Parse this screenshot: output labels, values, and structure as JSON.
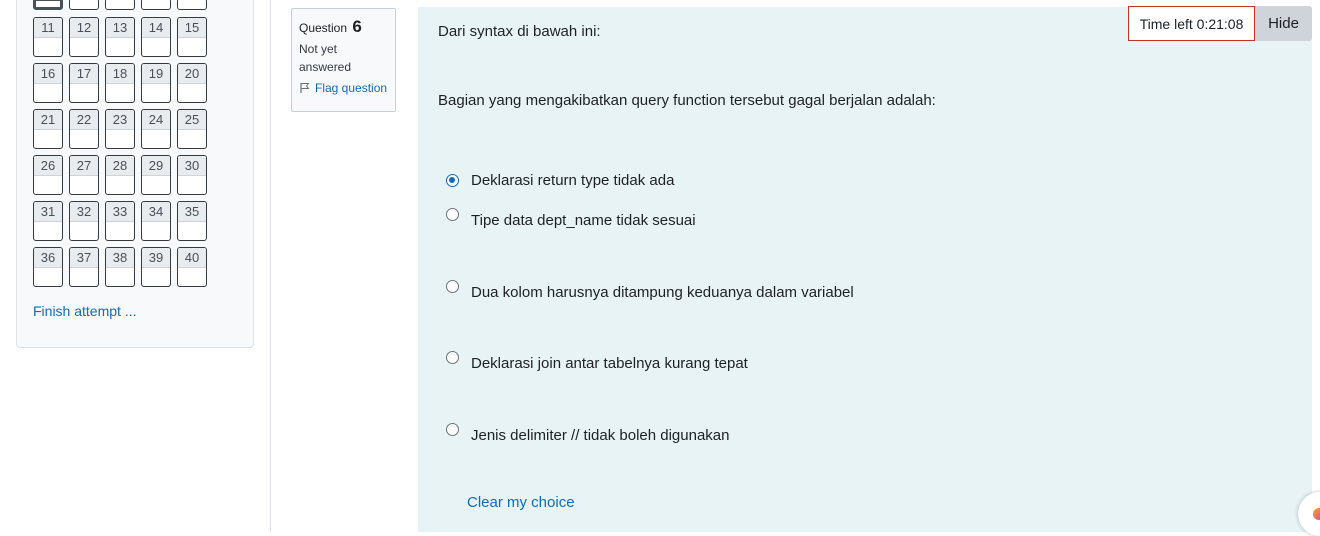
{
  "navigation": {
    "rows": [
      [
        "11",
        "12",
        "13",
        "14",
        "15"
      ],
      [
        "16",
        "17",
        "18",
        "19",
        "20"
      ],
      [
        "21",
        "22",
        "23",
        "24",
        "25"
      ],
      [
        "26",
        "27",
        "28",
        "29",
        "30"
      ],
      [
        "31",
        "32",
        "33",
        "34",
        "35"
      ],
      [
        "36",
        "37",
        "38",
        "39",
        "40"
      ]
    ],
    "finish_label": "Finish attempt ..."
  },
  "question_info": {
    "question_word": "Question",
    "number": "6",
    "state": "Not yet answered",
    "flag_label": "Flag question"
  },
  "question": {
    "intro": "Dari syntax di bawah ini:",
    "prompt": "Bagian yang mengakibatkan query function tersebut gagal berjalan adalah:",
    "options": [
      {
        "label": "Deklarasi return type tidak ada",
        "checked": true
      },
      {
        "label": "Tipe data dept_name tidak sesuai",
        "checked": false
      },
      {
        "label": "Dua kolom harusnya ditampung keduanya dalam variabel",
        "checked": false
      },
      {
        "label": "Deklarasi join antar tabelnya kurang tepat",
        "checked": false
      },
      {
        "label": "Jenis delimiter // tidak boleh digunakan",
        "checked": false
      }
    ],
    "clear_label": "Clear my choice"
  },
  "timer": {
    "text": "Time left 0:21:08",
    "hide_label": "Hide"
  },
  "colors": {
    "link": "#0f6cbf",
    "content_bg": "#e7f3f5",
    "timer_border": "#ca3120"
  }
}
